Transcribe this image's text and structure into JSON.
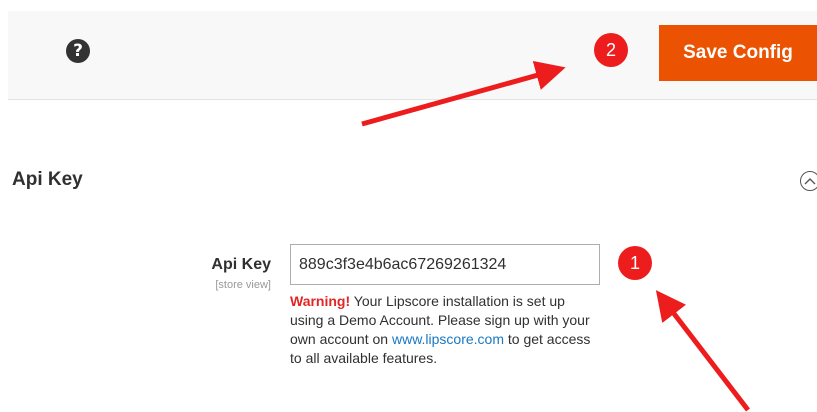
{
  "header": {
    "help_icon": "?",
    "save_button_label": "Save Config"
  },
  "section": {
    "title": "Api Key",
    "collapse_icon": "chevron-up"
  },
  "field": {
    "label": "Api Key",
    "scope": "[store view]",
    "value": "889c3f3e4b6ac67269261324"
  },
  "note": {
    "warning_label": "Warning!",
    "text_before_link": " Your Lipscore installation is set up using a Demo Account. Please sign up with your own account on ",
    "link_text": "www.lipscore.com",
    "text_after_link": " to get access to all available features."
  },
  "annotations": {
    "marker_1": "1",
    "marker_2": "2",
    "color": "#ee1d1d"
  },
  "colors": {
    "save_button": "#eb5202",
    "warning": "#e22626",
    "link": "#1979c3"
  }
}
